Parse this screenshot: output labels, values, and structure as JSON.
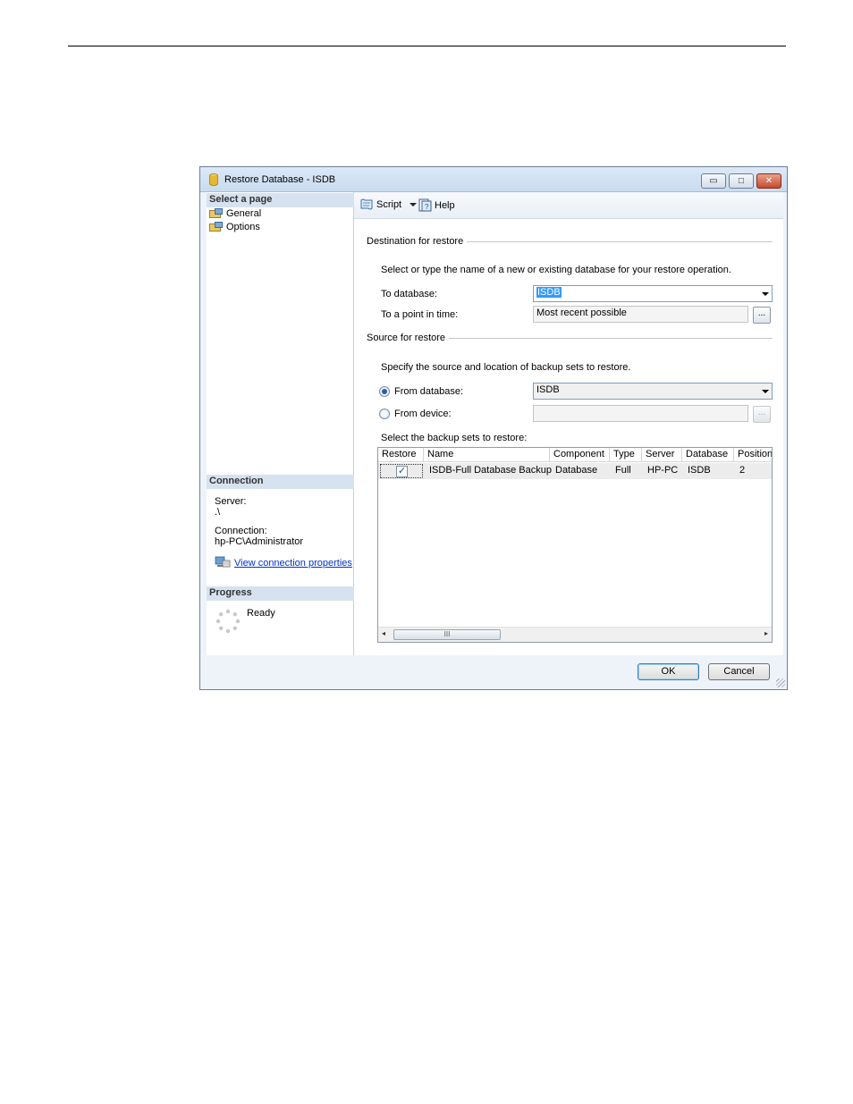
{
  "window": {
    "title": "Restore Database - ISDB",
    "controls": {
      "minimize": "▭",
      "maximize": "□",
      "close": "✕"
    }
  },
  "left": {
    "select_page_header": "Select a page",
    "pages": [
      {
        "label": "General",
        "icon": "page-icon"
      },
      {
        "label": "Options",
        "icon": "page-icon"
      }
    ],
    "connection_header": "Connection",
    "server_label": "Server:",
    "server_value": ".\\",
    "connection_label": "Connection:",
    "connection_value": "hp-PC\\Administrator",
    "view_connection_link": "View connection properties",
    "progress_header": "Progress",
    "progress_status": "Ready"
  },
  "toolbar": {
    "script_label": "Script",
    "help_label": "Help"
  },
  "destination": {
    "group_label": "Destination for restore",
    "instruction": "Select or type the name of a new or existing database for your restore operation.",
    "to_database_label": "To database:",
    "to_database_value": "ISDB",
    "point_in_time_label": "To a point in time:",
    "point_in_time_value": "Most recent possible",
    "browse_label": "..."
  },
  "source": {
    "group_label": "Source for restore",
    "instruction": "Specify the source and location of backup sets to restore.",
    "from_database_label": "From database:",
    "from_database_value": "ISDB",
    "from_device_label": "From device:",
    "from_device_value": "",
    "browse_label": "...",
    "backup_sets_label": "Select the backup sets to restore:"
  },
  "grid": {
    "columns": [
      "Restore",
      "Name",
      "Component",
      "Type",
      "Server",
      "Database",
      "Position"
    ],
    "rows": [
      {
        "restore": "✓",
        "name": "ISDB-Full Database Backup",
        "component": "Database",
        "type": "Full",
        "server": "HP-PC",
        "database": "ISDB",
        "position": "2"
      }
    ],
    "scroll_thumb": "III",
    "scroll_left": "◂",
    "scroll_right": "▸"
  },
  "buttons": {
    "ok": "OK",
    "cancel": "Cancel"
  },
  "colors": {
    "section_header": "#d6e2f0",
    "link": "#0033cc",
    "selection": "#3399ff"
  }
}
